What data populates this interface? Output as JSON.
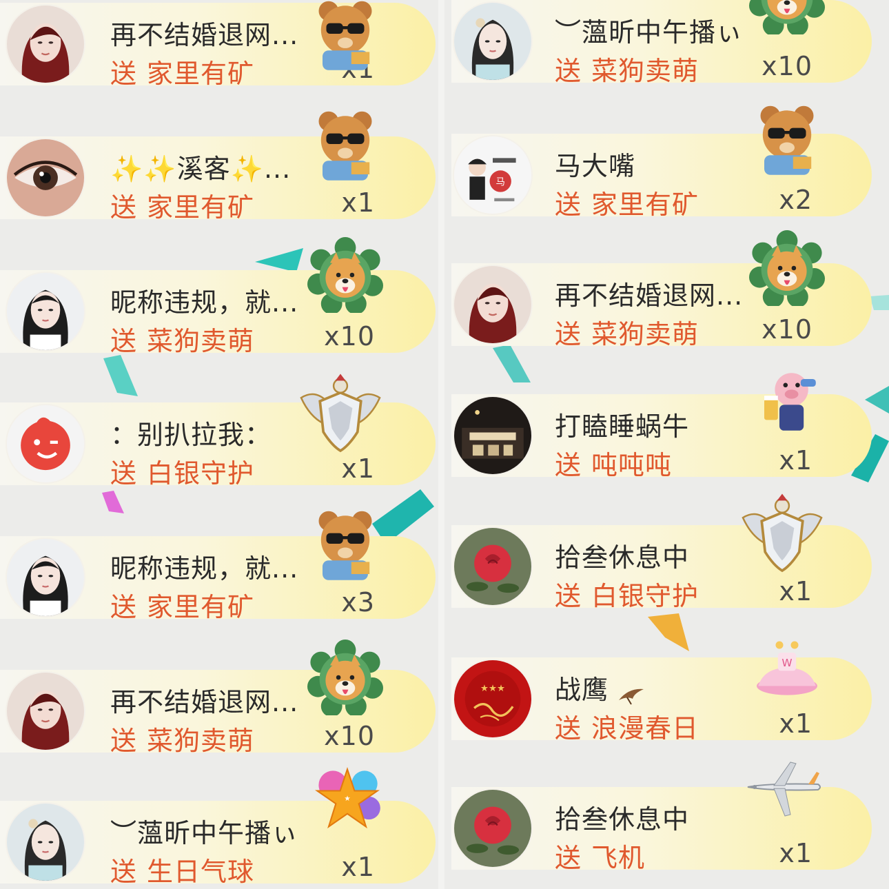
{
  "colors": {
    "send_text": "#e0592e",
    "username_text": "#2a2a2a",
    "quantity_text": "#4a4a4a",
    "pill_start": "#f7f6f0",
    "pill_end": "#fbf0a6"
  },
  "send_verb": "送",
  "left_column": [
    {
      "username": "再不结婚退网...",
      "gift": "家里有矿",
      "quantity": "x1",
      "gift_icon": "bear-sunglasses-icon",
      "avatar": "avatar-woman-red-hair"
    },
    {
      "username": "✨✨溪客✨...",
      "gift": "家里有矿",
      "quantity": "x1",
      "gift_icon": "bear-sunglasses-icon",
      "avatar": "avatar-eye-closeup"
    },
    {
      "username": "昵称违规，就...",
      "gift": "菜狗卖萌",
      "quantity": "x10",
      "gift_icon": "shiba-dog-icon",
      "avatar": "avatar-woman-dark-hair"
    },
    {
      "username": "：别扒拉我：",
      "gift": "白银守护",
      "quantity": "x1",
      "gift_icon": "silver-shield-icon",
      "avatar": "avatar-red-smiley"
    },
    {
      "username": "昵称违规，就...",
      "gift": "家里有矿",
      "quantity": "x3",
      "gift_icon": "bear-sunglasses-icon",
      "avatar": "avatar-woman-dark-hair"
    },
    {
      "username": "再不结婚退网...",
      "gift": "菜狗卖萌",
      "quantity": "x10",
      "gift_icon": "shiba-dog-icon",
      "avatar": "avatar-woman-red-hair"
    },
    {
      "username": "︶薀昕中午播ぃ",
      "gift": "生日气球",
      "quantity": "x1",
      "gift_icon": "birthday-balloon-icon",
      "avatar": "avatar-woman-traditional"
    }
  ],
  "right_column": [
    {
      "username": "︶薀昕中午播ぃ",
      "gift": "菜狗卖萌",
      "quantity": "x10",
      "gift_icon": "shiba-dog-icon",
      "avatar": "avatar-woman-traditional"
    },
    {
      "username": "马大嘴",
      "gift": "家里有矿",
      "quantity": "x2",
      "gift_icon": "bear-sunglasses-icon",
      "avatar": "avatar-cartoon-man"
    },
    {
      "username": "再不结婚退网...",
      "gift": "菜狗卖萌",
      "quantity": "x10",
      "gift_icon": "shiba-dog-icon",
      "avatar": "avatar-woman-red-hair"
    },
    {
      "username": "打瞌睡蜗牛",
      "gift": "吨吨吨",
      "quantity": "x1",
      "gift_icon": "pig-drinking-icon",
      "avatar": "avatar-night-street"
    },
    {
      "username": "拾叁休息中",
      "gift": "白银守护",
      "quantity": "x1",
      "gift_icon": "silver-shield-icon",
      "avatar": "avatar-red-rose"
    },
    {
      "username": "战鹰",
      "gift": "浪漫春日",
      "quantity": "x1",
      "gift_icon": "pink-cake-icon",
      "avatar": "avatar-red-calligraphy",
      "username_suffix_icon": "hawk-icon"
    },
    {
      "username": "拾叁休息中",
      "gift": "飞机",
      "quantity": "x1",
      "gift_icon": "airplane-icon",
      "avatar": "avatar-red-rose"
    }
  ]
}
